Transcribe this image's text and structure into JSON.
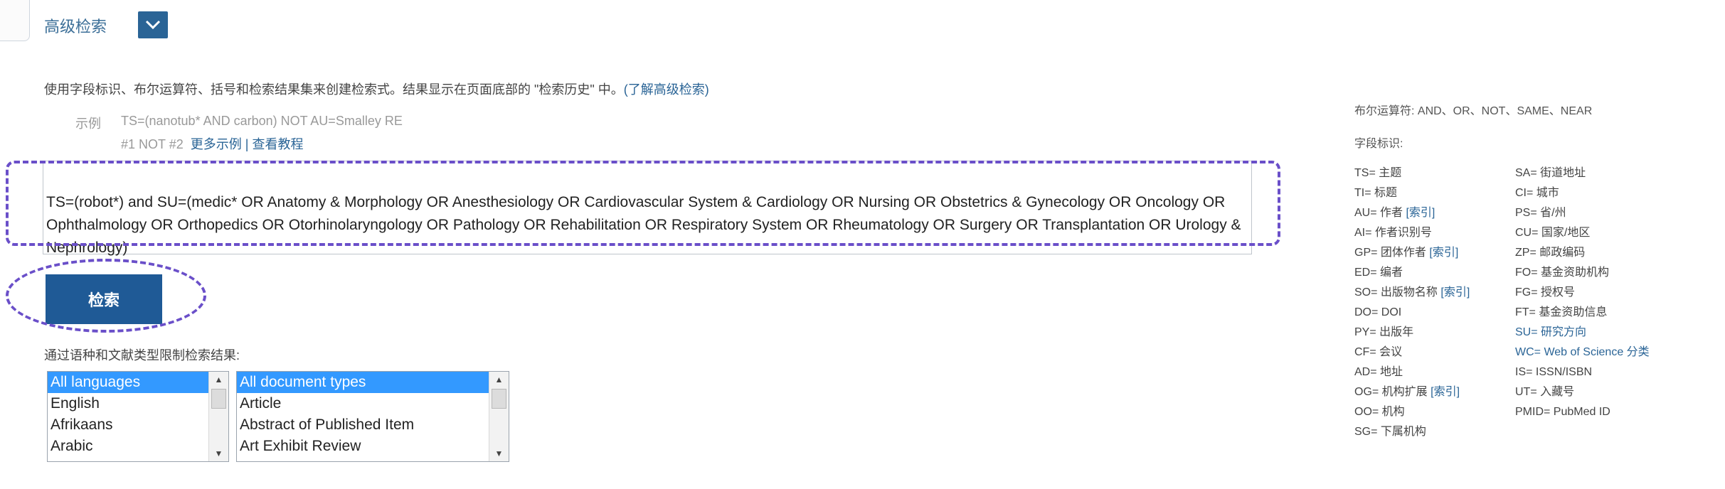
{
  "header": {
    "title": "高级检索"
  },
  "intro": {
    "text": "使用字段标识、布尔运算符、括号和检索结果集来创建检索式。结果显示在页面底部的 \"检索历史\" 中。",
    "link": "(了解高级检索)"
  },
  "example": {
    "label": "示例",
    "text": "TS=(nanotub* AND carbon) NOT AU=Smalley RE",
    "line2": "#1 NOT #2",
    "more_link": "更多示例",
    "separator": "|",
    "tutorial_link": "查看教程"
  },
  "query": {
    "value": "TS=(robot*) and SU=(medic* OR Anatomy & Morphology OR Anesthesiology OR Cardiovascular System & Cardiology OR Nursing OR Obstetrics & Gynecology OR Oncology OR Ophthalmology OR Orthopedics OR Otorhinolaryngology OR Pathology OR Rehabilitation OR Respiratory System OR Rheumatology OR Surgery OR Transplantation OR Urology & Nephrology)"
  },
  "search_button": {
    "label": "检索"
  },
  "limits": {
    "label": "通过语种和文献类型限制检索结果:",
    "languages": [
      "All languages",
      "English",
      "Afrikaans",
      "Arabic"
    ],
    "doc_types": [
      "All document types",
      "Article",
      "Abstract of Published Item",
      "Art Exhibit Review"
    ]
  },
  "sidebar": {
    "operators": "布尔运算符: AND、OR、NOT、SAME、NEAR",
    "fields_title": "字段标识:",
    "col1": [
      {
        "text": "TS= 主题"
      },
      {
        "text": "TI= 标题"
      },
      {
        "text": "AU= 作者",
        "link": "[索引]"
      },
      {
        "text": "AI= 作者识别号"
      },
      {
        "text": "GP= 团体作者",
        "link": "[索引]"
      },
      {
        "text": "ED= 编者"
      },
      {
        "text": "SO= 出版物名称",
        "link": "[索引]"
      },
      {
        "text": "DO= DOI"
      },
      {
        "text": "PY= 出版年"
      },
      {
        "text": "CF= 会议"
      },
      {
        "text": "AD= 地址"
      },
      {
        "text": "OG= 机构扩展",
        "link": "[索引]"
      },
      {
        "text": "OO= 机构"
      },
      {
        "text": "SG= 下属机构"
      }
    ],
    "col2": [
      {
        "text": "SA= 街道地址"
      },
      {
        "text": "CI= 城市"
      },
      {
        "text": "PS= 省/州"
      },
      {
        "text": "CU= 国家/地区"
      },
      {
        "text": "ZP= 邮政编码"
      },
      {
        "text": "FO= 基金资助机构"
      },
      {
        "text": "FG= 授权号"
      },
      {
        "text": "FT= 基金资助信息"
      },
      {
        "text": "SU= 研究方向",
        "link_color": true
      },
      {
        "text": "WC= Web of Science 分类",
        "link_color": true
      },
      {
        "text": "IS= ISSN/ISBN"
      },
      {
        "text": "UT= 入藏号"
      },
      {
        "text": "PMID= PubMed ID"
      }
    ]
  }
}
